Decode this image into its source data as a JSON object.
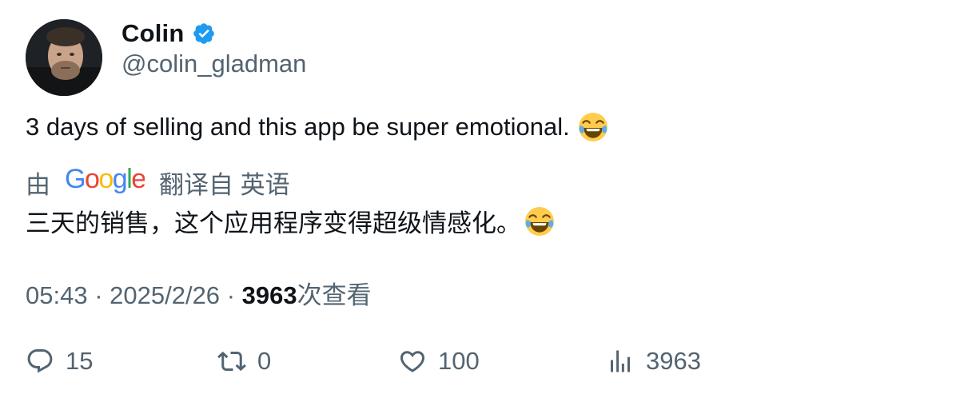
{
  "user": {
    "display_name": "Colin",
    "handle": "@colin_gladman",
    "verified": true
  },
  "tweet": {
    "text": "3 days of selling and this app be super emotional.",
    "emoji": "face-with-tears-of-joy-icon"
  },
  "translation": {
    "prefix": "由",
    "provider": "Google",
    "suffix": "翻译自 英语",
    "text": "三天的销售，这个应用程序变得超级情感化。"
  },
  "meta": {
    "time": "05:43",
    "separator": "·",
    "date": "2025/2/26",
    "views_count": "3963",
    "views_label": "次查看"
  },
  "actions": {
    "replies": "15",
    "retweets": "0",
    "likes": "100",
    "views": "3963"
  },
  "colors": {
    "verified_blue": "#1d9bf0",
    "secondary_text": "#536471",
    "primary_text": "#0f1419"
  }
}
